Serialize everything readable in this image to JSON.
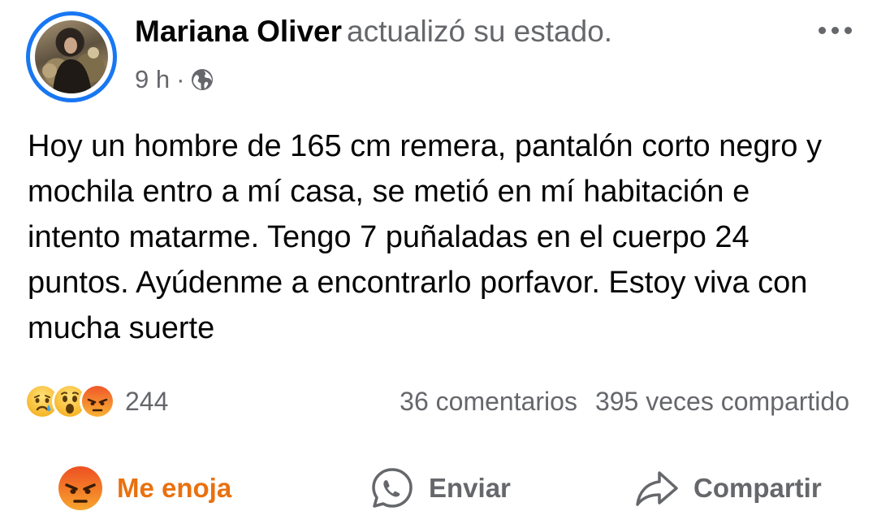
{
  "post": {
    "author": "Mariana Oliver",
    "action_text": "actualizó su estado.",
    "time": "9 h",
    "separator": "·",
    "privacy_icon": "globe-icon",
    "text": "Hoy un hombre de 165 cm remera, pantalón corto negro y mochila entro a mí casa, se metió en mí habitación e intento matarme. Tengo 7 puñaladas en el cuerpo 24 puntos. Ayúdenme a encontrarlo porfavor. Estoy viva con mucha suerte"
  },
  "reactions": {
    "icons": [
      "sad-reaction-icon",
      "wow-reaction-icon",
      "angry-reaction-icon"
    ],
    "count": "244",
    "comments": "36 comentarios",
    "shares": "395 veces compartido"
  },
  "actions": {
    "react_label": "Me enoja",
    "send_label": "Enviar",
    "share_label": "Compartir"
  },
  "colors": {
    "accent": "#1877f2",
    "angry": "#e9710f",
    "muted": "#65676b"
  }
}
